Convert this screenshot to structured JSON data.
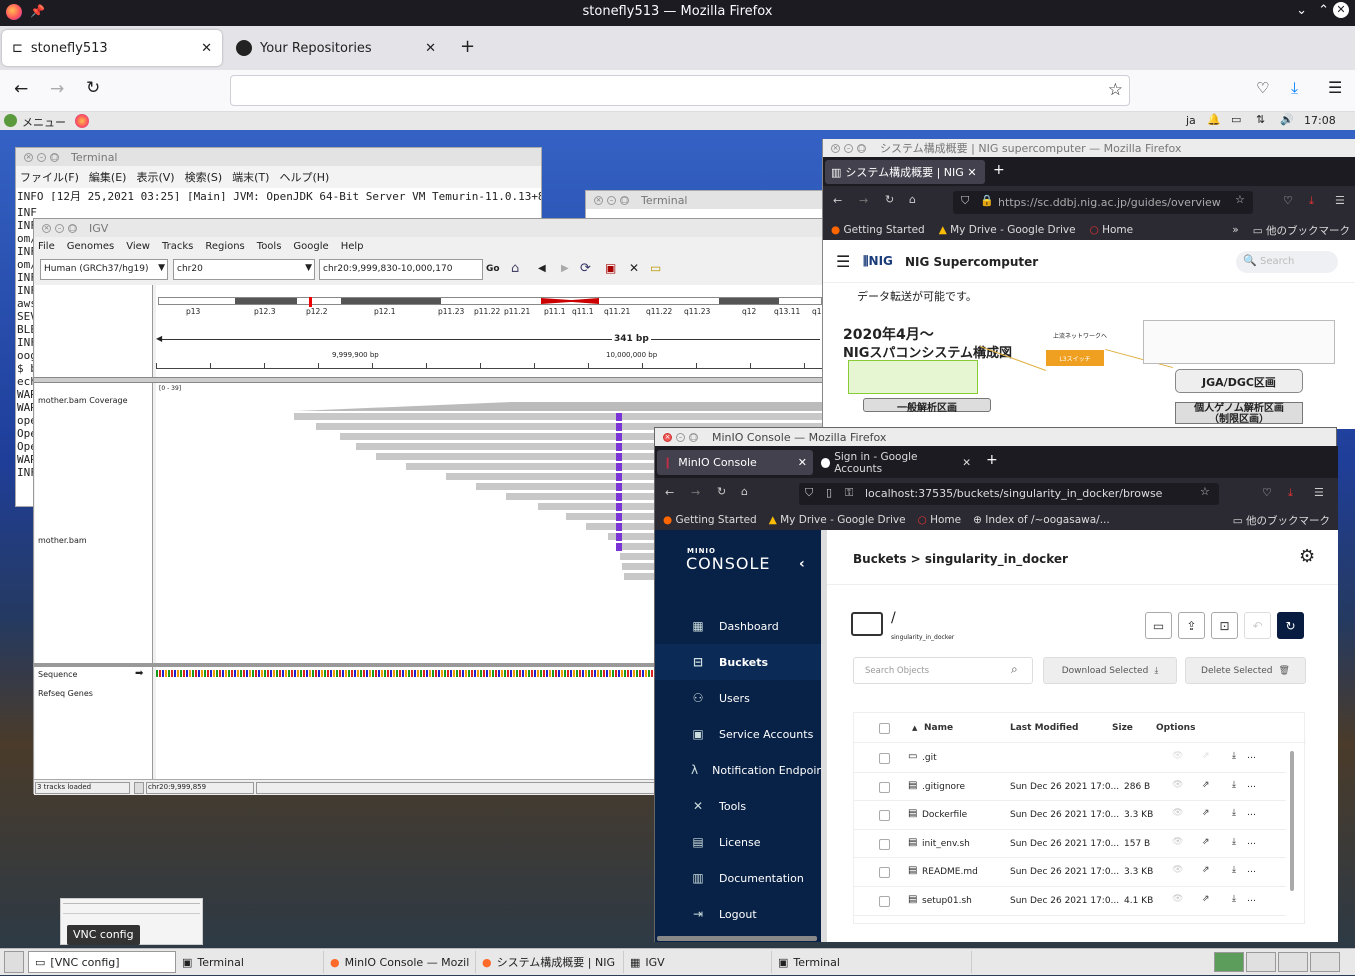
{
  "outer_browser": {
    "title": "stonefly513 — Mozilla Firefox",
    "tabs": [
      {
        "label": "stonefly513",
        "active": true
      },
      {
        "label": "Your Repositories",
        "active": false
      }
    ]
  },
  "desktop_bar": {
    "menu_label": "メニュー",
    "lang": "ja",
    "clock": "17:08"
  },
  "terminal1": {
    "title": "Terminal",
    "menu": [
      "ファイル(F)",
      "編集(E)",
      "表示(V)",
      "検索(S)",
      "端末(T)",
      "ヘルプ(H)"
    ],
    "first_line": "INFO [12月 25,2021 03:25] [Main] JVM: OpenJDK 64-Bit Server VM Temurin-11.0.13+8",
    "left_fragments": [
      "INF",
      "INF",
      "om/",
      "INF",
      "om/",
      "INF",
      "INF",
      "aws",
      "SEV",
      "BLE",
      "INF",
      "oog",
      "$ b",
      "ech",
      "WAR",
      "WAR",
      "ope",
      "Ope",
      "Ope",
      "WAR",
      "INF"
    ]
  },
  "terminal2": {
    "title": "Terminal"
  },
  "igv": {
    "title": "IGV",
    "menu": [
      "File",
      "Genomes",
      "View",
      "Tracks",
      "Regions",
      "Tools",
      "Google",
      "Help"
    ],
    "genome": "Human (GRCh37/hg19)",
    "chromosome": "chr20",
    "locus": "chr20:9,999,830-10,000,170",
    "go_label": "Go",
    "bands": [
      "p13",
      "p12.3",
      "p12.2",
      "p12.1",
      "p11.23",
      "p11.22",
      "p11.21",
      "p11.1",
      "q11.1",
      "q11.21",
      "q11.22",
      "q11.23",
      "q12",
      "q13.11",
      "q13"
    ],
    "span_label": "341 bp",
    "tick_left": "9,999,900 bp",
    "tick_right": "10,000,000 bp",
    "coverage_range": "[0 - 39]",
    "tracks": {
      "coverage": "mother.bam Coverage",
      "bam": "mother.bam",
      "sequence": "Sequence",
      "refseq": "Refseq Genes"
    },
    "status_left": "3 tracks loaded",
    "status_pos": "chr20:9,999,859"
  },
  "nig_window": {
    "title": "システム構成概要 | NIG supercomputer — Mozilla Firefox",
    "tab_label": "システム構成概要 | NIG s",
    "url": "https://sc.ddbj.nig.ac.jp/guides/overview",
    "bookmarks": [
      "Getting Started",
      "My Drive - Google Drive",
      "Home"
    ],
    "bookmark_folder": "他のブックマーク",
    "site_name": "NIG Supercomputer",
    "search_placeholder": "Search",
    "body_text": "データ転送が可能です。",
    "diagram_title_1": "2020年4月～",
    "diagram_title_2": "NIGスパコンシステム構成図",
    "box_jga": "JGA/DGC区画",
    "box_general": "一般解析区画",
    "box_personal_1": "個人ゲノム解析区画",
    "box_personal_2": "（制限区画）",
    "top_label": "上流ネットワークへ",
    "switch_label": "L3スイッチ"
  },
  "minio_window": {
    "title": "MinIO Console — Mozilla Firefox",
    "tabs": [
      {
        "label": "MinIO Console",
        "active": true
      },
      {
        "label": "Sign in - Google Accounts",
        "active": false
      }
    ],
    "url": "localhost:37535/buckets/singularity_in_docker/browse",
    "bookmarks": [
      "Getting Started",
      "My Drive - Google Drive",
      "Home",
      "Index of /~oogasawa/..."
    ],
    "bookmark_folder": "他のブックマーク",
    "logo_small": "MINIO",
    "logo_big": "CONSOLE",
    "sidebar": [
      {
        "label": "Dashboard",
        "icon": "dashboard-icon",
        "glyph": "▦"
      },
      {
        "label": "Buckets",
        "icon": "bucket-icon",
        "glyph": "⊟",
        "active": true
      },
      {
        "label": "Users",
        "icon": "user-icon",
        "glyph": "⚇"
      },
      {
        "label": "Service Accounts",
        "icon": "service-accounts-icon",
        "glyph": "▣"
      },
      {
        "label": "Notification Endpoints",
        "icon": "lambda-icon",
        "glyph": "λ"
      },
      {
        "label": "Tools",
        "icon": "tools-icon",
        "glyph": "✕"
      },
      {
        "label": "License",
        "icon": "license-icon",
        "glyph": "▤"
      },
      {
        "label": "Documentation",
        "icon": "documentation-icon",
        "glyph": "▥"
      },
      {
        "label": "Logout",
        "icon": "logout-icon",
        "glyph": "⇥"
      }
    ],
    "breadcrumb": "Buckets > singularity_in_docker",
    "path": "/",
    "bucket_name": "singularity_in_docker",
    "search_placeholder": "Search Objects",
    "download_selected": "Download Selected",
    "delete_selected": "Delete Selected",
    "columns": {
      "name": "Name",
      "modified": "Last Modified",
      "size": "Size",
      "options": "Options"
    },
    "files": [
      {
        "name": ".git",
        "modified": "",
        "size": "",
        "folder": true
      },
      {
        "name": ".gitignore",
        "modified": "Sun Dec 26 2021 17:0...",
        "size": "286 B"
      },
      {
        "name": "Dockerfile",
        "modified": "Sun Dec 26 2021 17:0...",
        "size": "3.3 KB"
      },
      {
        "name": "init_env.sh",
        "modified": "Sun Dec 26 2021 17:0...",
        "size": "157 B"
      },
      {
        "name": "README.md",
        "modified": "Sun Dec 26 2021 17:0...",
        "size": "3.3 KB"
      },
      {
        "name": "setup01.sh",
        "modified": "Sun Dec 26 2021 17:0...",
        "size": "4.1 KB"
      }
    ]
  },
  "vnc_tooltip": "VNC config",
  "taskbar": [
    {
      "label": "[VNC config]",
      "icon": "vnc-icon"
    },
    {
      "label": "Terminal",
      "icon": "terminal-icon"
    },
    {
      "label": "MinIO Console — Mozill...",
      "icon": "firefox-icon"
    },
    {
      "label": "システム構成概要 | NIG ...",
      "icon": "firefox-icon"
    },
    {
      "label": "IGV",
      "icon": "igv-icon"
    },
    {
      "label": "Terminal",
      "icon": "terminal-icon"
    }
  ]
}
